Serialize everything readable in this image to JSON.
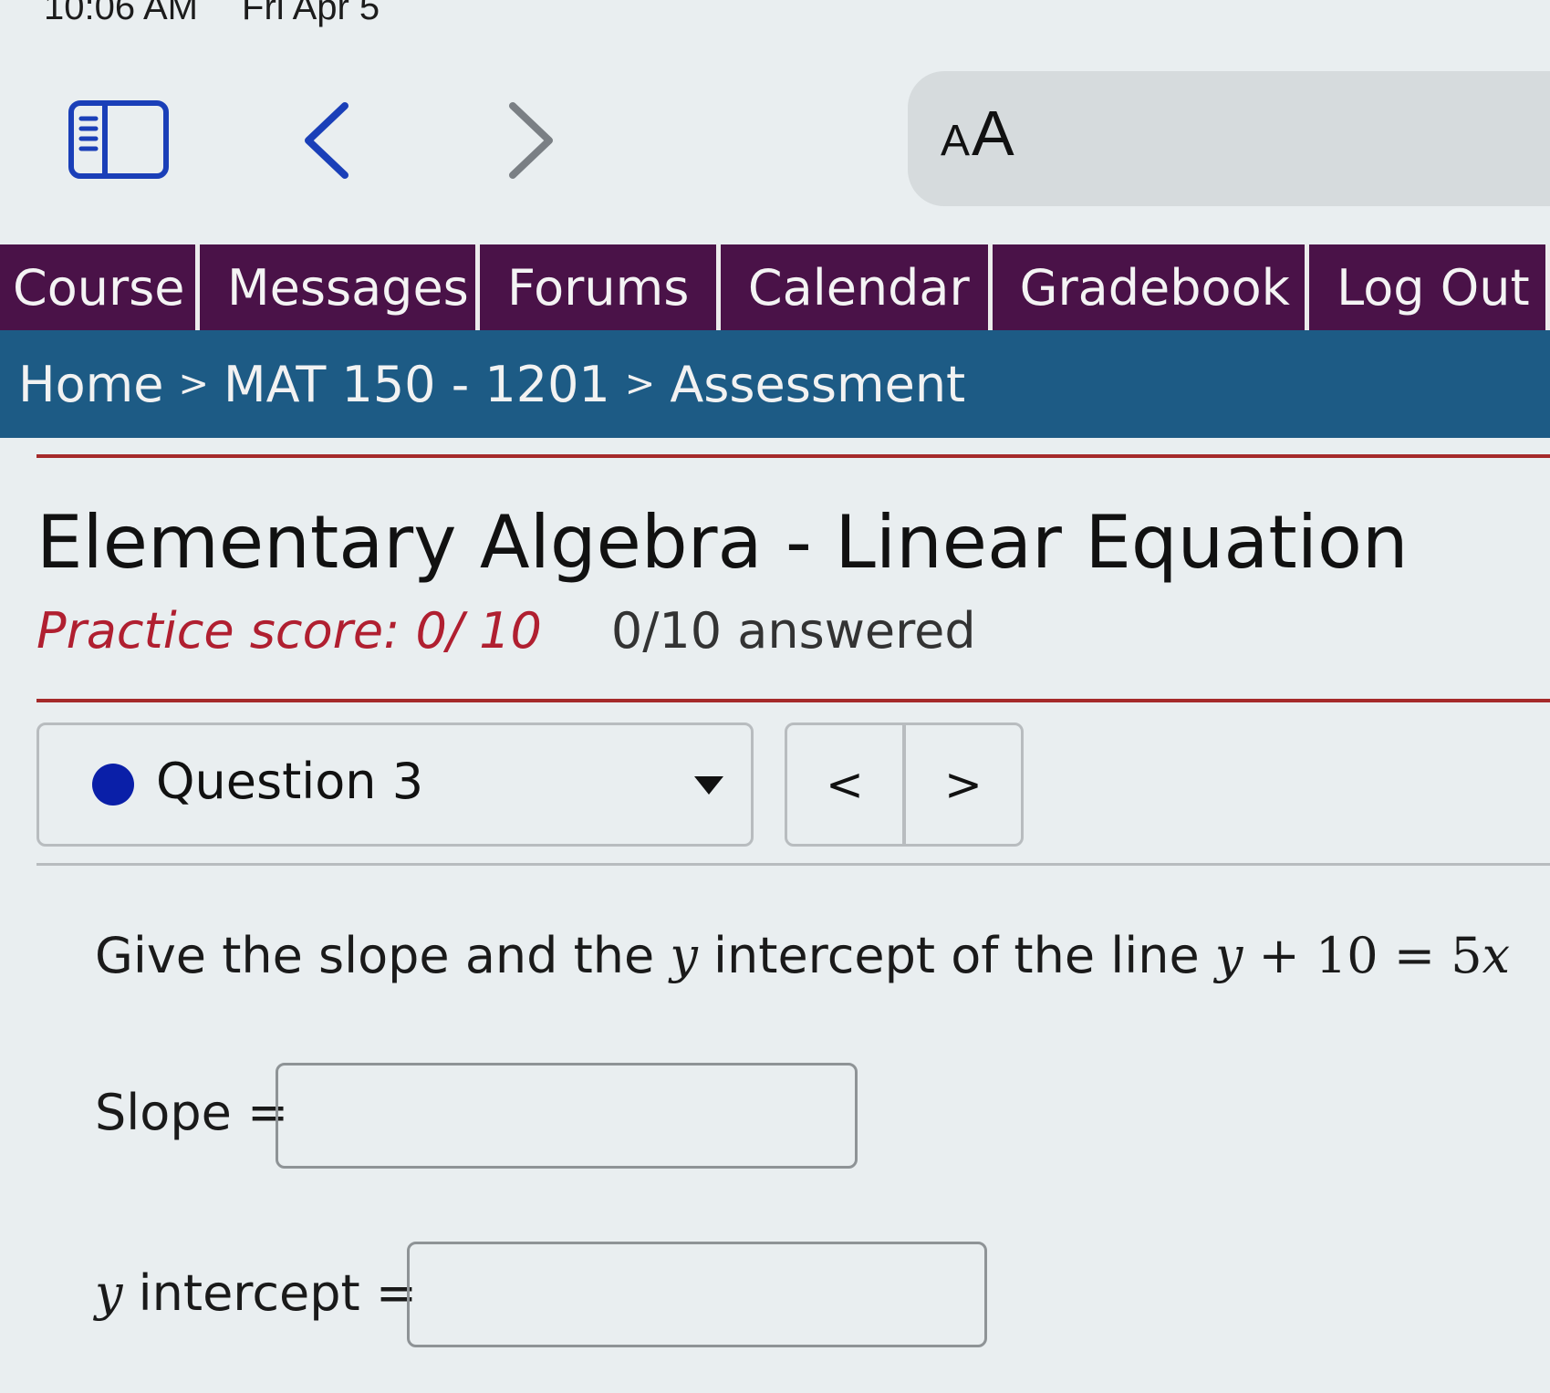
{
  "status_bar": {
    "time": "10:06 AM",
    "date": "Fri Apr 5"
  },
  "browser": {
    "reader_label_small": "A",
    "reader_label_big": "A"
  },
  "nav": {
    "items": [
      {
        "label": "Course"
      },
      {
        "label": "Messages"
      },
      {
        "label": "Forums"
      },
      {
        "label": "Calendar"
      },
      {
        "label": "Gradebook"
      },
      {
        "label": "Log Out"
      }
    ]
  },
  "breadcrumb": {
    "items": [
      "Home",
      "MAT 150 - 1201",
      "Assessment"
    ],
    "separator": ">"
  },
  "page": {
    "title": "Elementary Algebra - Linear Equation",
    "practice_score": "Practice score: 0/ 10",
    "answered": "0/10 answered"
  },
  "question_nav": {
    "selected": "Question 3",
    "prev": "<",
    "next": ">"
  },
  "question": {
    "prompt_prefix": "Give the slope and the ",
    "prompt_var": "y",
    "prompt_middle": " intercept of the line ",
    "equation": {
      "lhs_var": "y",
      "plus": "+",
      "constant": "10",
      "equals": "=",
      "coef": "5",
      "rhs_var": "x"
    },
    "slope_label": "Slope =",
    "slope_value": "",
    "intercept_var": "y",
    "intercept_label": " intercept =",
    "intercept_value": ""
  },
  "colors": {
    "nav_bg": "#4a1248",
    "breadcrumb_bg": "#1d5b85",
    "score_red": "#b01f30",
    "dot_blue": "#0a1fa8",
    "rule_red": "#a52a2a",
    "toolbar_blue": "#1a3fb8"
  }
}
